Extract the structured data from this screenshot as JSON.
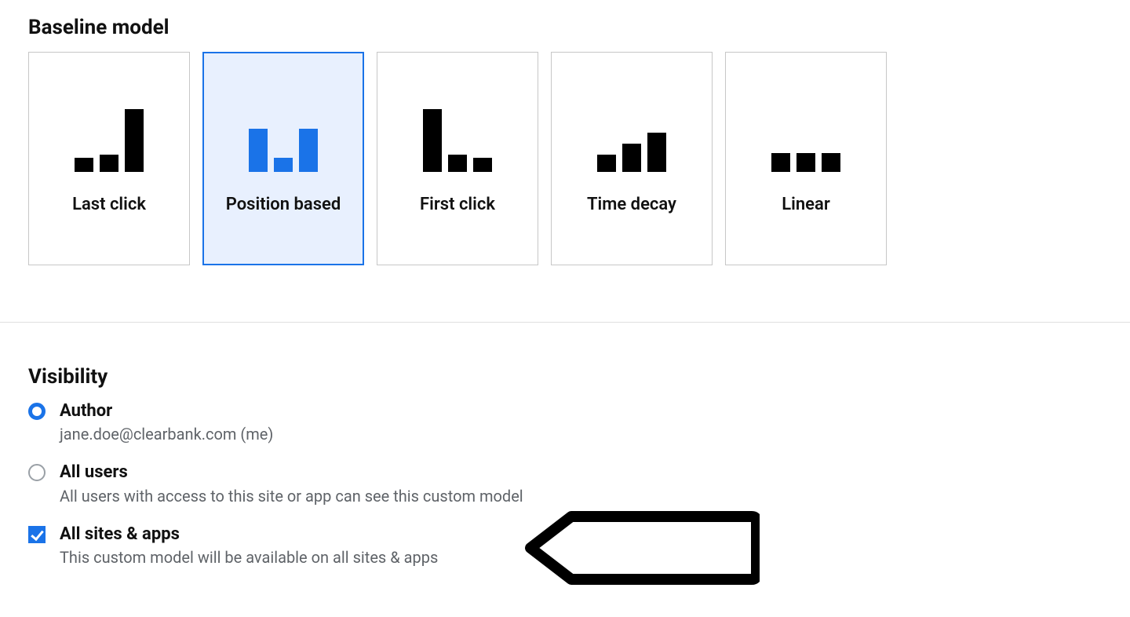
{
  "baseline": {
    "title": "Baseline model",
    "models": {
      "last_click": {
        "label": "Last click",
        "bars": [
          18,
          22,
          80
        ]
      },
      "position_based": {
        "label": "Position based",
        "bars": [
          55,
          18,
          55
        ],
        "selected": true
      },
      "first_click": {
        "label": "First click",
        "bars": [
          80,
          22,
          18
        ]
      },
      "time_decay": {
        "label": "Time decay",
        "bars": [
          22,
          36,
          50
        ]
      },
      "linear": {
        "label": "Linear",
        "bars": [
          24,
          24,
          24
        ]
      }
    }
  },
  "visibility": {
    "title": "Visibility",
    "options": {
      "author": {
        "label": "Author",
        "desc": "jane.doe@clearbank.com (me)",
        "type": "radio",
        "checked": true
      },
      "all_users": {
        "label": "All users",
        "desc": "All users with access to this site or app can see this custom model",
        "type": "radio",
        "checked": false
      },
      "all_sites": {
        "label": "All sites & apps",
        "desc": "This custom model will be available on all sites & apps",
        "type": "checkbox",
        "checked": true
      }
    }
  }
}
